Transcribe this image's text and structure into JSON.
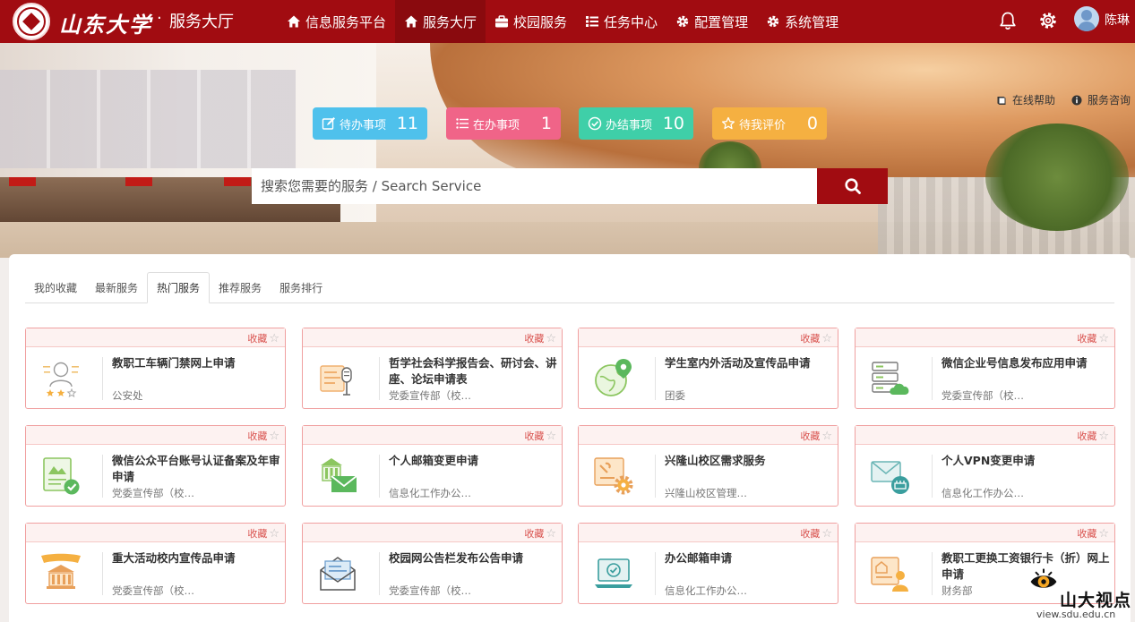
{
  "header": {
    "brand": "山东大学",
    "separator": "·",
    "subtitle": "服务大厅",
    "nav": [
      {
        "label": "信息服务平台",
        "icon": "home-icon",
        "active": false
      },
      {
        "label": "服务大厅",
        "icon": "home-icon",
        "active": true
      },
      {
        "label": "校园服务",
        "icon": "briefcase-icon",
        "active": false
      },
      {
        "label": "任务中心",
        "icon": "task-list-icon",
        "active": false
      },
      {
        "label": "配置管理",
        "icon": "gear-icon",
        "active": false
      },
      {
        "label": "系统管理",
        "icon": "gear-icon",
        "active": false
      }
    ],
    "username": "陈琳"
  },
  "hero": {
    "help": "在线帮助",
    "consult": "服务咨询",
    "stats": [
      {
        "label": "待办事项",
        "count": "11",
        "color": "#4fc1ec",
        "icon": "edit-icon"
      },
      {
        "label": "在办事项",
        "count": "1",
        "color": "#f06488",
        "icon": "list-icon"
      },
      {
        "label": "办结事项",
        "count": "10",
        "color": "#3fcfa8",
        "icon": "check-circle-icon"
      },
      {
        "label": "待我评价",
        "count": "0",
        "color": "#f5b041",
        "icon": "star-icon"
      }
    ],
    "search_placeholder": "搜索您需要的服务 / Search Service"
  },
  "tabs": [
    {
      "label": "我的收藏",
      "active": false
    },
    {
      "label": "最新服务",
      "active": false
    },
    {
      "label": "热门服务",
      "active": true
    },
    {
      "label": "推荐服务",
      "active": false
    },
    {
      "label": "服务排行",
      "active": false
    }
  ],
  "fav_label": "收藏",
  "services": [
    {
      "title": "教职工车辆门禁网上申请",
      "dept": "公安处",
      "icon": "person-stars-icon"
    },
    {
      "title": "哲学社会科学报告会、研讨会、讲座、论坛申请表",
      "dept": "党委宣传部（校…",
      "icon": "microphone-icon"
    },
    {
      "title": "学生室内外活动及宣传品申请",
      "dept": "团委",
      "icon": "globe-pin-icon"
    },
    {
      "title": "微信企业号信息发布应用申请",
      "dept": "党委宣传部（校…",
      "icon": "server-cloud-icon"
    },
    {
      "title": "微信公众平台账号认证备案及年审申请",
      "dept": "党委宣传部（校…",
      "icon": "certificate-check-icon"
    },
    {
      "title": "个人邮箱变更申请",
      "dept": "信息化工作办公…",
      "icon": "building-mail-icon"
    },
    {
      "title": "兴隆山校区需求服务",
      "dept": "兴隆山校区管理…",
      "icon": "tools-gear-icon"
    },
    {
      "title": "个人VPN变更申请",
      "dept": "信息化工作办公…",
      "icon": "mail-network-icon"
    },
    {
      "title": "重大活动校内宣传品申请",
      "dept": "党委宣传部（校…",
      "icon": "banner-building-icon"
    },
    {
      "title": "校园网公告栏发布公告申请",
      "dept": "党委宣传部（校…",
      "icon": "mail-open-icon"
    },
    {
      "title": "办公邮箱申请",
      "dept": "信息化工作办公…",
      "icon": "laptop-check-icon"
    },
    {
      "title": "教职工更换工资银行卡（折）网上申请",
      "dept": "财务部",
      "icon": "house-person-icon"
    }
  ],
  "watermark": {
    "text": "山大视点",
    "url": "view.sdu.edu.cn"
  }
}
